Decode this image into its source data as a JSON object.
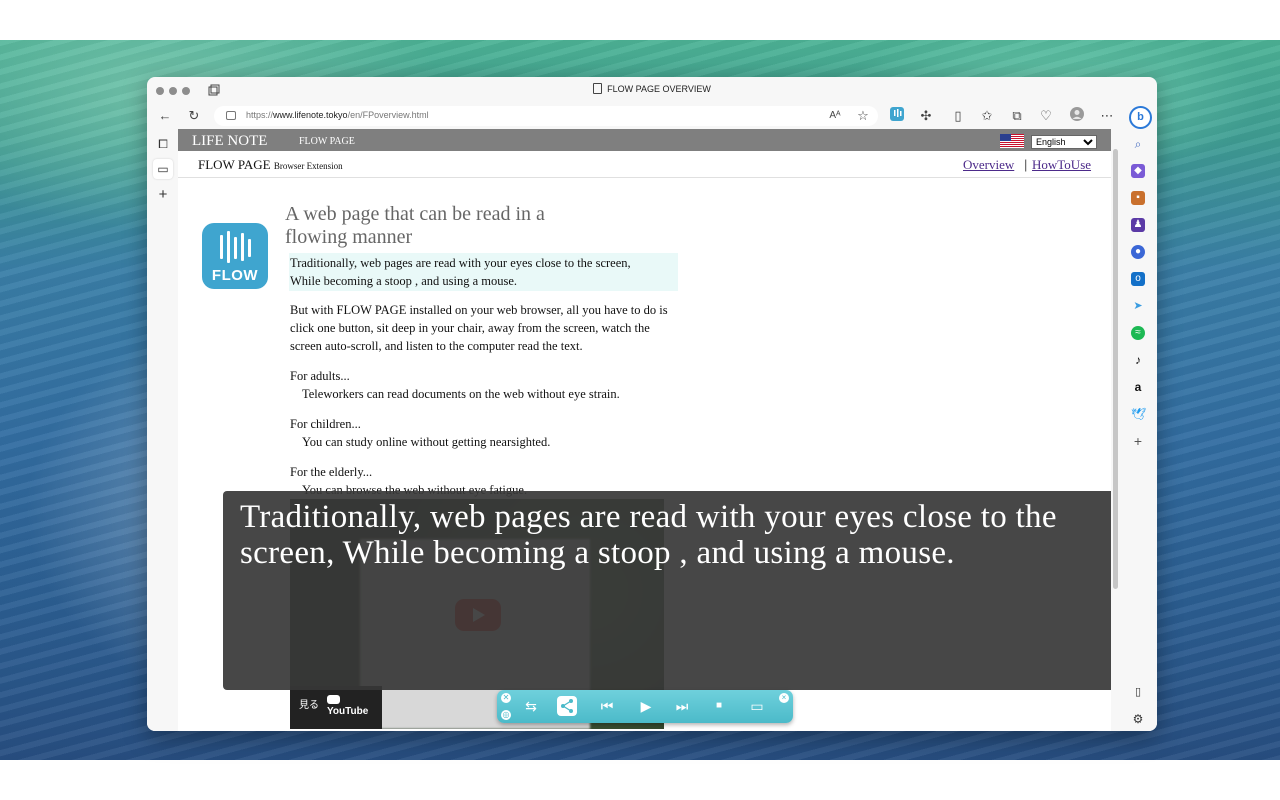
{
  "browser": {
    "tab_title": "FLOW PAGE OVERVIEW",
    "url_prefix": "https://",
    "url_host": "www.lifenote.tokyo",
    "url_path": "/en/FPoverview.html"
  },
  "site": {
    "brand": "LIFE NOTE",
    "nav_link": "FLOW PAGE",
    "language": "English",
    "product_name": "FLOW PAGE",
    "product_suffix": "Browser Extension",
    "links": [
      "Overview",
      "HowToUse"
    ],
    "separator": "|"
  },
  "logo": {
    "text": "FLOW"
  },
  "article": {
    "headline": "A web page that can be read in a flowing manner",
    "p1_line1": "Traditionally, web pages are read with your eyes close to the screen,",
    "p1_line2": "While becoming a stoop , and using a mouse.",
    "p2": "But with FLOW PAGE installed on your web browser, all you have to do is click one button, sit deep in your chair, away from the screen, watch the screen auto-scroll, and listen to the computer read the text.",
    "adults_title": "For adults...",
    "adults_text": "Teleworkers can read documents on the web without eye strain.",
    "children_title": "For children...",
    "children_text": "You can study online without getting nearsighted.",
    "elderly_title": "For the elderly...",
    "elderly_text": "You can browse the web without eye fatigue."
  },
  "video": {
    "watch_label": "見る",
    "platform": "YouTube"
  },
  "caption": {
    "text": "Traditionally, web pages are read with your eyes close to the screen, While becoming a stoop , and using a mouse."
  },
  "colors": {
    "nav_bg": "#7f7f7f",
    "highlight_bg": "#e9f9f8",
    "player_accent": "#4bbac9",
    "logo_bg": "#3fa5cf",
    "link": "#4c2a8a"
  }
}
